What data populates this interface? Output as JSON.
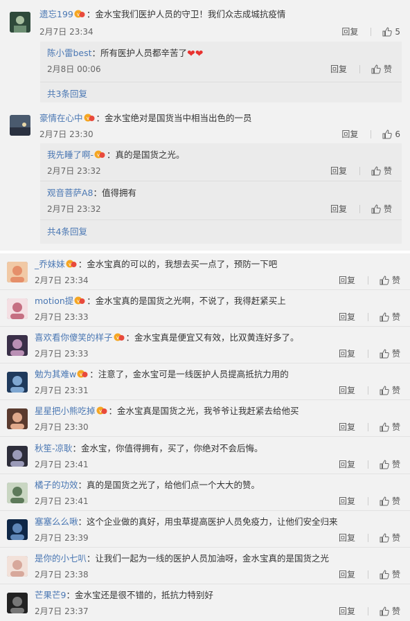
{
  "labels": {
    "reply": "回复",
    "like": "赞"
  },
  "top": [
    {
      "user": "遗忘199",
      "text": "：金水宝我们医护人员的守卫！我们众志成城抗疫情",
      "time": "2月7日 23:34",
      "likes": "5",
      "replies": [
        {
          "user": "陈小雷best",
          "text": "：所有医护人员都辛苦了",
          "time": "2月8日 00:06",
          "hearts": "❤❤"
        }
      ],
      "more": "共3条回复"
    },
    {
      "user": "豪情在心中",
      "text": "：金水宝绝对是国货当中相当出色的一员",
      "time": "2月7日 23:30",
      "likes": "6",
      "replies": [
        {
          "user": "我先睡了啊-",
          "text": "：真的是国货之光。",
          "time": "2月7日 23:32"
        },
        {
          "user": "观音菩萨A8",
          "text": "：值得拥有",
          "time": "2月7日 23:32"
        }
      ],
      "more": "共4条回复"
    }
  ],
  "bottom": [
    {
      "user": "_乔妹妹",
      "text": "：金水宝真的可以的，我想去买一点了，预防一下吧",
      "time": "2月7日 23:34"
    },
    {
      "user": "motion提",
      "text": "：金水宝真的是国货之光啊，不说了，我得赶紧买上",
      "time": "2月7日 23:33"
    },
    {
      "user": "喜欢看你傻笑的样子",
      "text": "：金水宝真是便宜又有效，比双黄连好多了。",
      "time": "2月7日 23:33"
    },
    {
      "user": "勉为其难w",
      "text": "：注意了，金水宝可是一线医护人员提高抵抗力用的",
      "time": "2月7日 23:31"
    },
    {
      "user": "星星把小熊吃掉",
      "text": "：金水宝真是国货之光，我爷爷让我赶紧去给他买",
      "time": "2月7日 23:30"
    },
    {
      "user": "秋笙-凉耿",
      "text": "：金水宝，你值得拥有，买了，你绝对不会后悔。",
      "time": "2月7日 23:41"
    },
    {
      "user": "橘子的功效",
      "text": "：真的是国货之光了，给他们点一个大大的赞。",
      "time": "2月7日 23:41"
    },
    {
      "user": "塞塞么么啾",
      "text": "：这个企业做的真好，用虫草提高医护人员免疫力，让他们安全归来",
      "time": "2月7日 23:39"
    },
    {
      "user": "是你的小七叭",
      "text": "：让我们一起为一线的医护人员加油呀，金水宝真的是国货之光",
      "time": "2月7日 23:38"
    },
    {
      "user": "芒果芒9",
      "text": "：金水宝还是很不错的，抵抗力特别好",
      "time": "2月7日 23:37"
    }
  ]
}
